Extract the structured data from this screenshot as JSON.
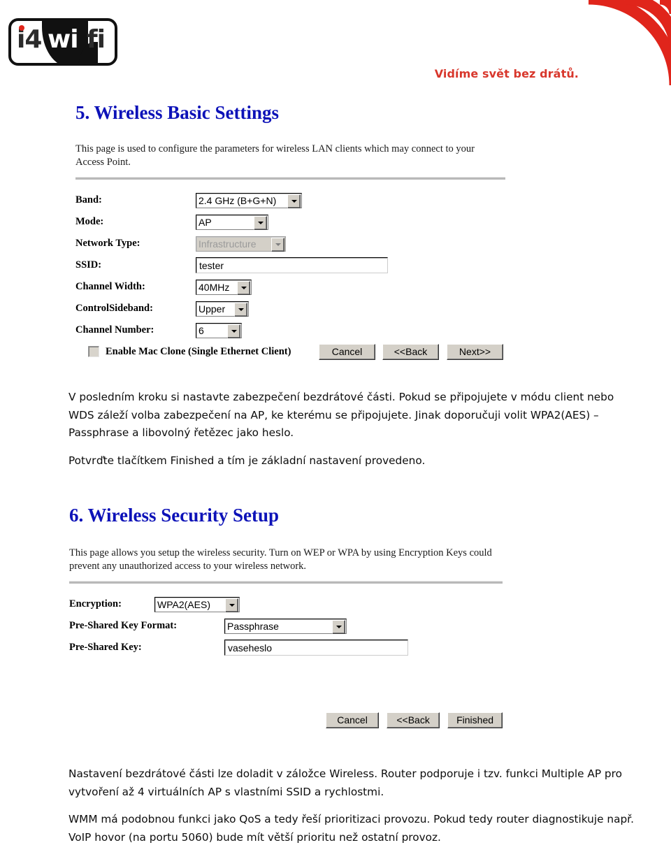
{
  "header": {
    "logo_text_left": "i4",
    "logo_text_mid": "wi",
    "logo_text_right": "fi",
    "tagline": "Vidíme svět bez drátů.",
    "brand_red": "#d8372c",
    "heading_blue": "#0d12b8"
  },
  "section5": {
    "title": "5. Wireless Basic Settings",
    "description": "This page is used to configure the parameters for wireless LAN clients which may connect to your Access Point.",
    "fields": [
      {
        "label": "Band:",
        "control": "select",
        "value": "2.4 GHz (B+G+N)",
        "disabled": false
      },
      {
        "label": "Mode:",
        "control": "select",
        "value": "AP",
        "disabled": false
      },
      {
        "label": "Network Type:",
        "control": "select",
        "value": "Infrastructure",
        "disabled": true
      },
      {
        "label": "SSID:",
        "control": "text",
        "value": "tester",
        "disabled": false
      },
      {
        "label": "Channel Width:",
        "control": "select",
        "value": "40MHz",
        "disabled": false
      },
      {
        "label": "ControlSideband:",
        "control": "select",
        "value": "Upper",
        "disabled": false
      },
      {
        "label": "Channel Number:",
        "control": "select",
        "value": "6",
        "disabled": false
      }
    ],
    "checkbox": {
      "label": "Enable Mac Clone (Single Ethernet Client)",
      "checked": false
    },
    "buttons": [
      "Cancel",
      "<<Back",
      "Next>>"
    ]
  },
  "note1": {
    "paragraph1": "V posledním kroku si nastavte zabezpečení bezdrátové části. Pokud se připojujete v módu client nebo WDS záleží volba zabezpečení na AP, ke kterému se připojujete. Jinak doporučuji volit WPA2(AES) – Passphrase a libovolný řetězec jako heslo.",
    "paragraph2": "Potvrďte tlačítkem Finished a tím je základní nastavení provedeno."
  },
  "section6": {
    "title": "6. Wireless Security Setup",
    "description": "This page allows you setup the wireless security. Turn on WEP or WPA by using Encryption Keys could prevent any unauthorized access to your wireless network.",
    "fields": [
      {
        "label": "Encryption:",
        "control": "select",
        "value": "WPA2(AES)",
        "disabled": false
      },
      {
        "label": "Pre-Shared Key Format:",
        "control": "select",
        "value": "Passphrase",
        "disabled": false
      },
      {
        "label": "Pre-Shared Key:",
        "control": "text",
        "value": "vaseheslo",
        "disabled": false
      }
    ],
    "buttons": [
      "Cancel",
      "<<Back",
      "Finished"
    ]
  },
  "note2": {
    "paragraph1": "Nastavení bezdrátové části lze doladit v záložce Wireless. Router podporuje i tzv. funkci Multiple AP pro vytvoření až 4 virtuálních AP s vlastními SSID a rychlostmi.",
    "paragraph2": "WMM má podobnou funkci jako QoS a tedy řeší prioritizaci provozu. Pokud tedy router diagnostikuje např. VoIP hovor (na portu 5060) bude mít větší prioritu než ostatní provoz."
  }
}
